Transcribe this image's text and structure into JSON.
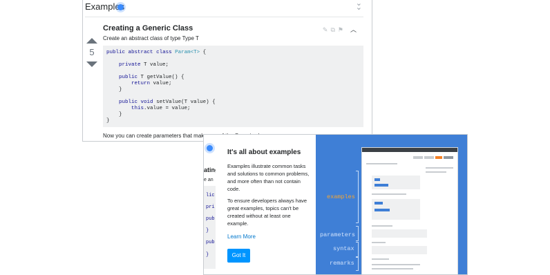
{
  "examples_panel": {
    "header_title": "Examples",
    "example_title": "Creating a Generic Class",
    "example_description": "Create an abstract class of type Type T",
    "vote_score": "5",
    "code_lines": [
      "public abstract class Param<T> {",
      "",
      "    private T value;",
      "",
      "    public T getValue() {",
      "        return value;",
      "    }",
      "",
      "    public void setValue(T value) {",
      "        this.value = value;",
      "    }",
      "}"
    ],
    "after_text": "Now you can create parameters that make use of the Generic class"
  },
  "modal": {
    "title": "It's all about examples",
    "paragraph_1": "Examples illustrate common tasks and solutions to common problems, and more often than not contain code.",
    "paragraph_2": "To ensure developers always have great examples, topics can't be created without at least one example.",
    "learn_more": "Learn More",
    "got_it": "Got It",
    "peek": {
      "title_fragment": "ating",
      "desc_fragment": "e an",
      "code_fragments": [
        "lic",
        "pri",
        "pub",
        "}",
        "pub",
        "}"
      ]
    },
    "illustration_labels": [
      "examples",
      "parameters",
      "syntax",
      "remarks"
    ],
    "highlighted_label": "examples",
    "colors": {
      "accent_blue": "#3f7fd6",
      "label_highlight": "#f4a533",
      "button": "#0095ff"
    }
  }
}
